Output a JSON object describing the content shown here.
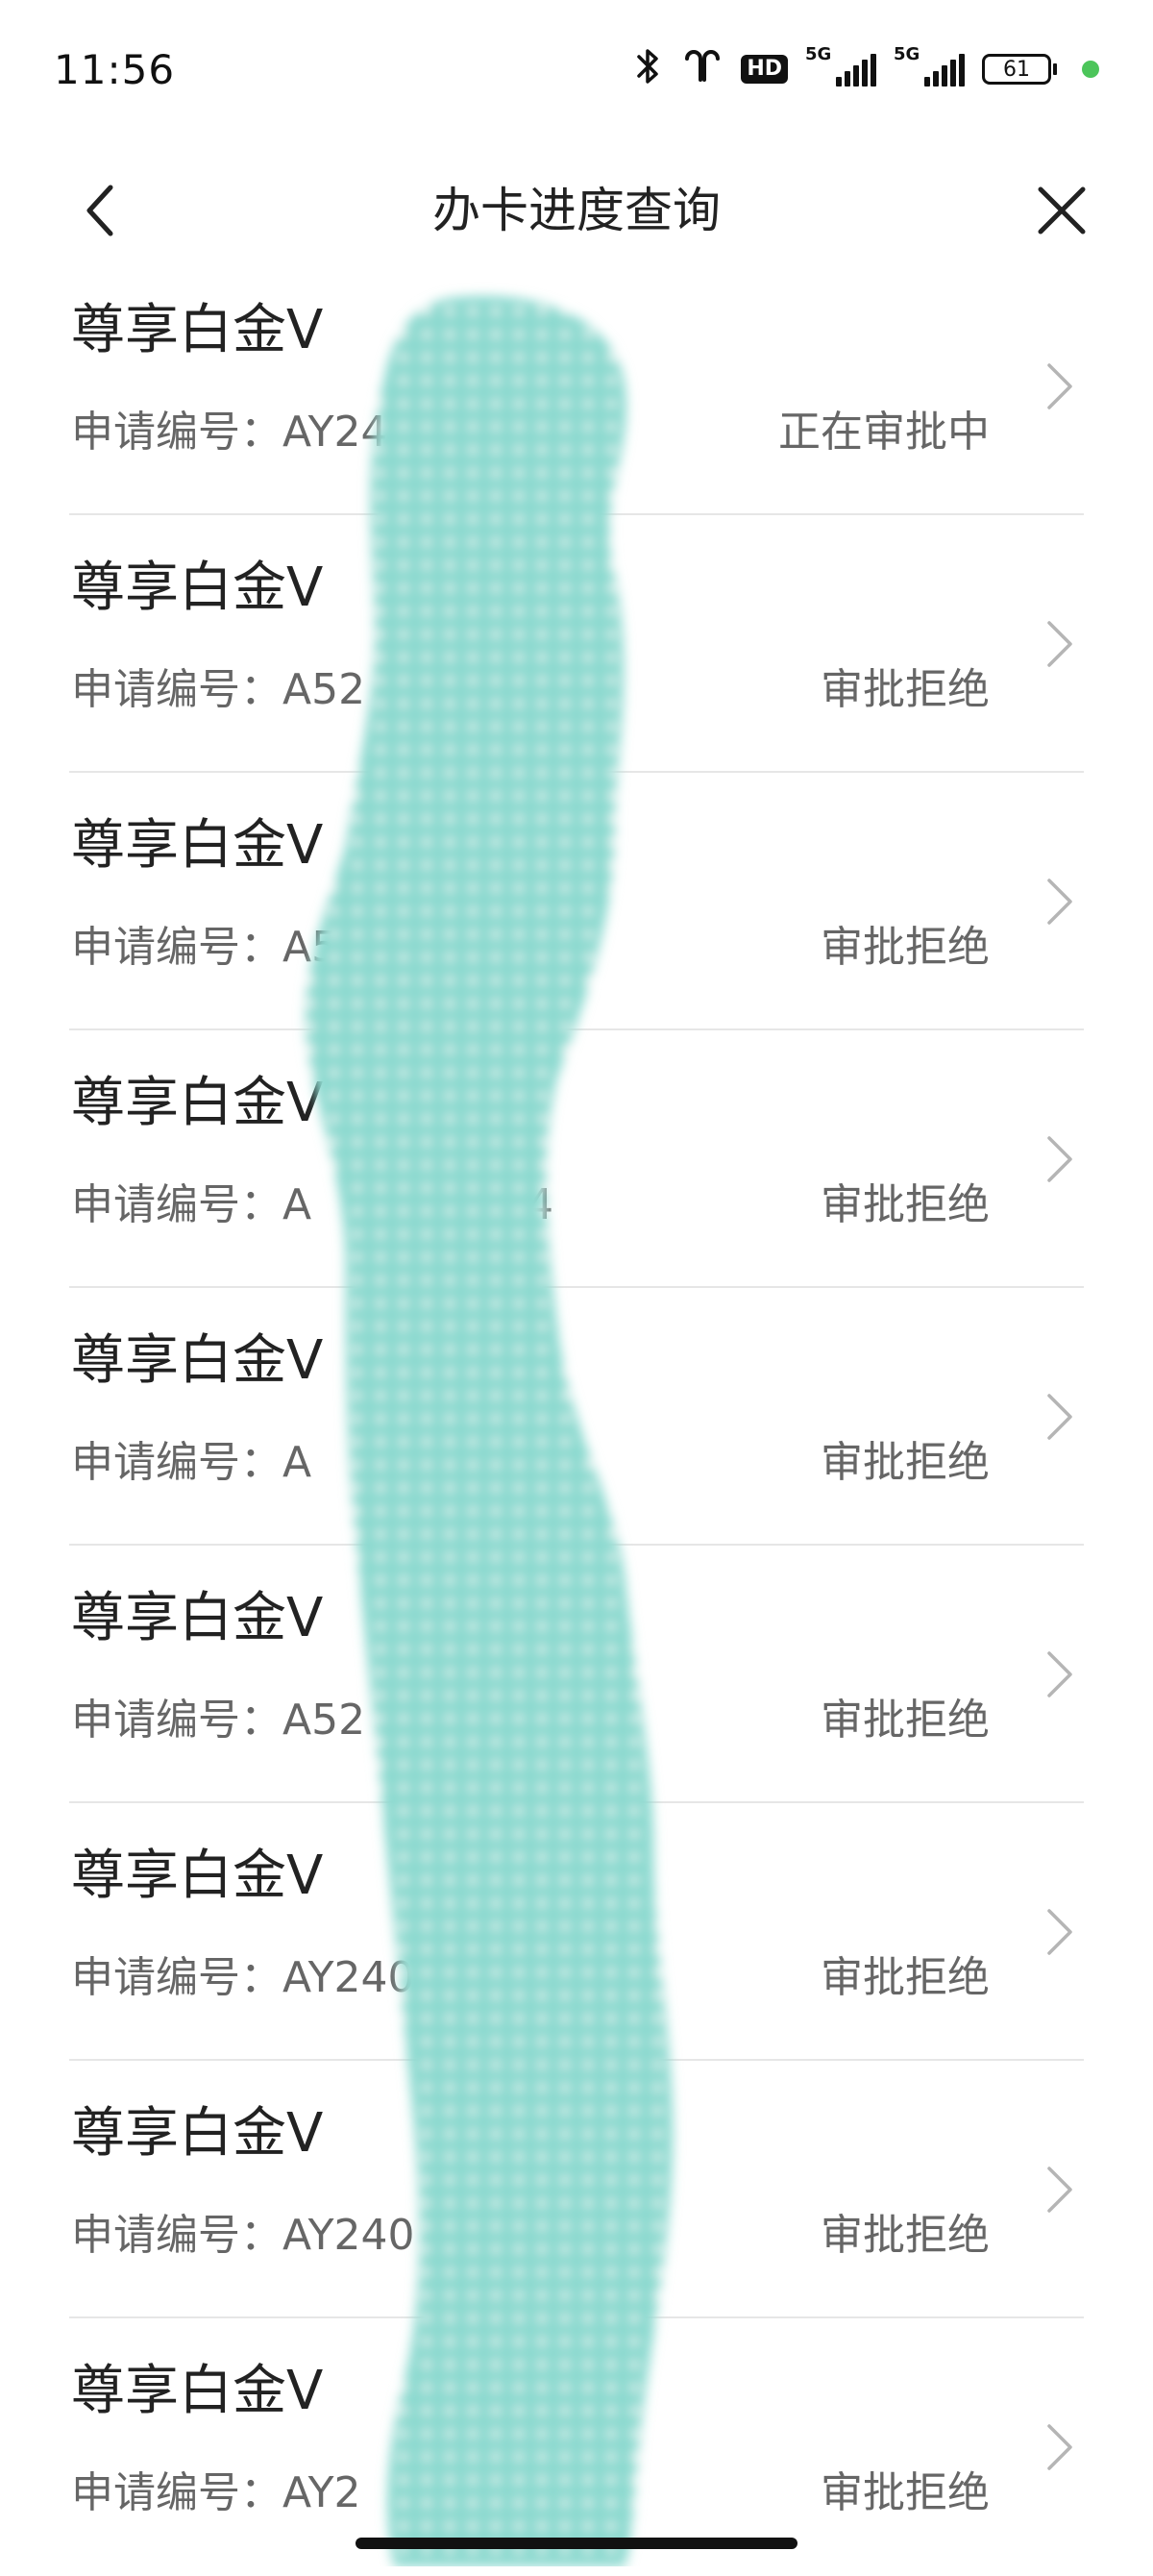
{
  "status_bar": {
    "time": "11:56",
    "icons": [
      "bluetooth-icon",
      "earbuds-icon",
      "hd-icon",
      "signal-5g-icon",
      "signal-5g-icon",
      "battery-icon"
    ],
    "hd_label": "HD",
    "network_labels": [
      "5G",
      "5G"
    ],
    "battery_level": "61",
    "accent_dot_color": "#4cc55a"
  },
  "nav": {
    "title": "办卡进度查询",
    "back_icon": "chevron-left-icon",
    "close_icon": "close-icon"
  },
  "applications": {
    "items": [
      {
        "card": "尊享白金V",
        "label": "申请编号：",
        "number": "AY24          22",
        "status": "正在审批中"
      },
      {
        "card": "尊享白金V",
        "label": "申请编号：",
        "number": "A52          05",
        "status": "审批拒绝"
      },
      {
        "card": "尊享白金V",
        "label": "申请编号：",
        "number": "A5          70",
        "status": "审批拒绝"
      },
      {
        "card": "尊享白金V",
        "label": "申请编号：",
        "number": "A          3084",
        "status": "审批拒绝"
      },
      {
        "card": "尊享白金V",
        "label": "申请编号：",
        "number": "A          901",
        "status": "审批拒绝"
      },
      {
        "card": "尊享白金V",
        "label": "申请编号：",
        "number": "A52          29",
        "status": "审批拒绝"
      },
      {
        "card": "尊享白金V",
        "label": "申请编号：",
        "number": "AY240",
        "status": "审批拒绝"
      },
      {
        "card": "尊享白金V",
        "label": "申请编号：",
        "number": "AY240",
        "status": "审批拒绝"
      },
      {
        "card": "尊享白金V",
        "label": "申请编号：",
        "number": "AY2          2",
        "status": "审批拒绝"
      }
    ]
  },
  "colors": {
    "mask": "#8ad9cf",
    "divider": "#e6e6e6",
    "primary_text": "#222222",
    "secondary_text": "#666666"
  }
}
